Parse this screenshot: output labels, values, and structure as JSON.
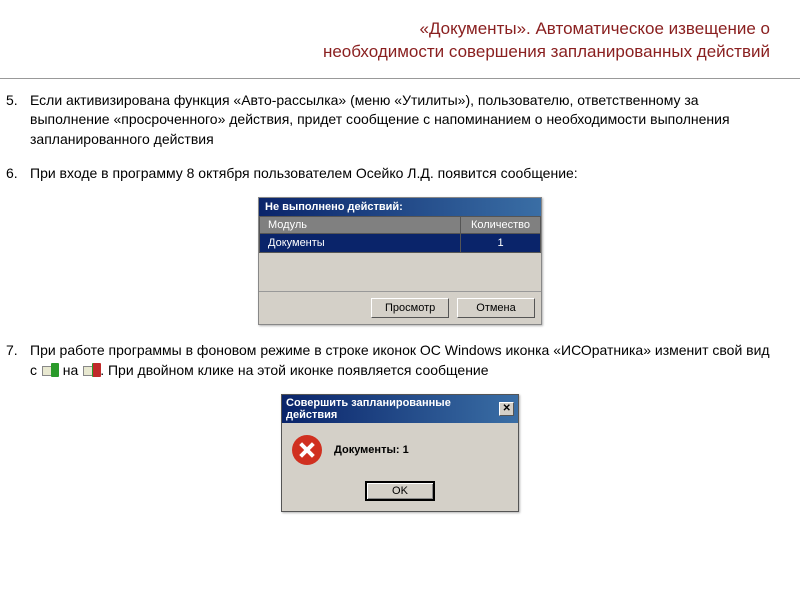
{
  "header": {
    "line1": "«Документы». Автоматическое извещение о",
    "line2": "необходимости совершения запланированных действий"
  },
  "items": {
    "i5": {
      "num": "5.",
      "text": "Если активизирована функция «Авто-рассылка» (меню «Утилиты»), пользователю, ответственному за выполнение «просроченного» действия, придет сообщение с напоминанием о необходимости выполнения запланированного действия"
    },
    "i6": {
      "num": "6.",
      "text": "При входе в программу 8 октября пользователем Осейко Л.Д. появится сообщение:"
    },
    "i7": {
      "num": "7.",
      "text_a": "При работе программы в фоновом режиме в строке иконок ОС Windows иконка «ИСОратника» изменит свой вид с",
      "text_b": "на",
      "text_c": ". При двойном клике на этой иконке появляется сообщение"
    }
  },
  "dialog1": {
    "title": "Не выполнено действий:",
    "col_module": "Модуль",
    "col_count": "Количество",
    "row_module": "Документы",
    "row_count": "1",
    "btn_view": "Просмотр",
    "btn_cancel": "Отмена"
  },
  "dialog2": {
    "title": "Совершить запланированные действия",
    "message": "Документы: 1",
    "btn_ok": "OK",
    "close_glyph": "✕"
  }
}
